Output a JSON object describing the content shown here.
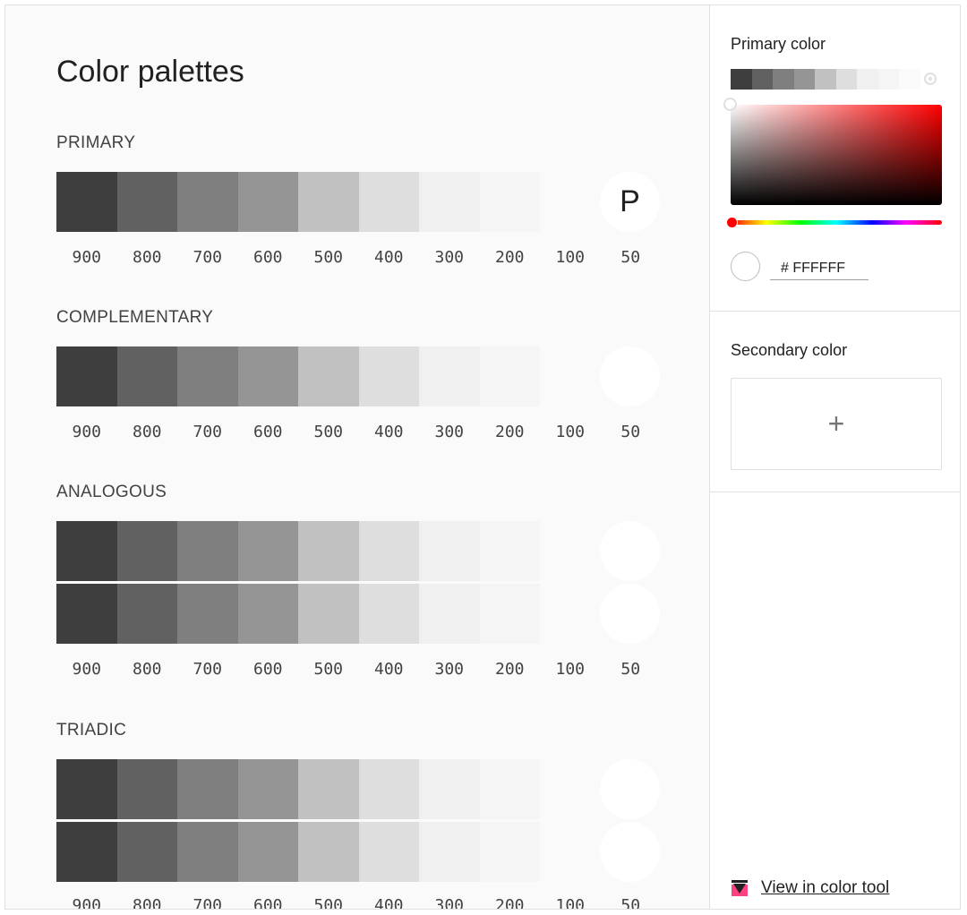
{
  "page": {
    "title": "Color palettes"
  },
  "shade_labels": [
    "900",
    "800",
    "700",
    "600",
    "500",
    "400",
    "300",
    "200",
    "100",
    "50"
  ],
  "swatch_colors": [
    "#3e3e3e",
    "#616161",
    "#7f7f7f",
    "#959595",
    "#c1c1c1",
    "#dedede",
    "#f0f0f0",
    "#f5f5f5",
    "#fafafa"
  ],
  "sections": {
    "primary": {
      "title": "PRIMARY",
      "circle_letter": "P"
    },
    "complementary": {
      "title": "COMPLEMENTARY"
    },
    "analogous": {
      "title": "ANALOGOUS"
    },
    "triadic": {
      "title": "TRIADIC"
    }
  },
  "panel": {
    "primary": {
      "heading": "Primary color",
      "hex_value": "# FFFFFF",
      "mini_strip_colors": [
        "#3e3e3e",
        "#616161",
        "#7f7f7f",
        "#959595",
        "#c1c1c1",
        "#dedede",
        "#f0f0f0",
        "#f5f5f5",
        "#fafafa"
      ],
      "hue_color": "#ff0000"
    },
    "secondary": {
      "heading": "Secondary color",
      "add_label": "+"
    },
    "link": {
      "label": "View in color tool"
    }
  }
}
